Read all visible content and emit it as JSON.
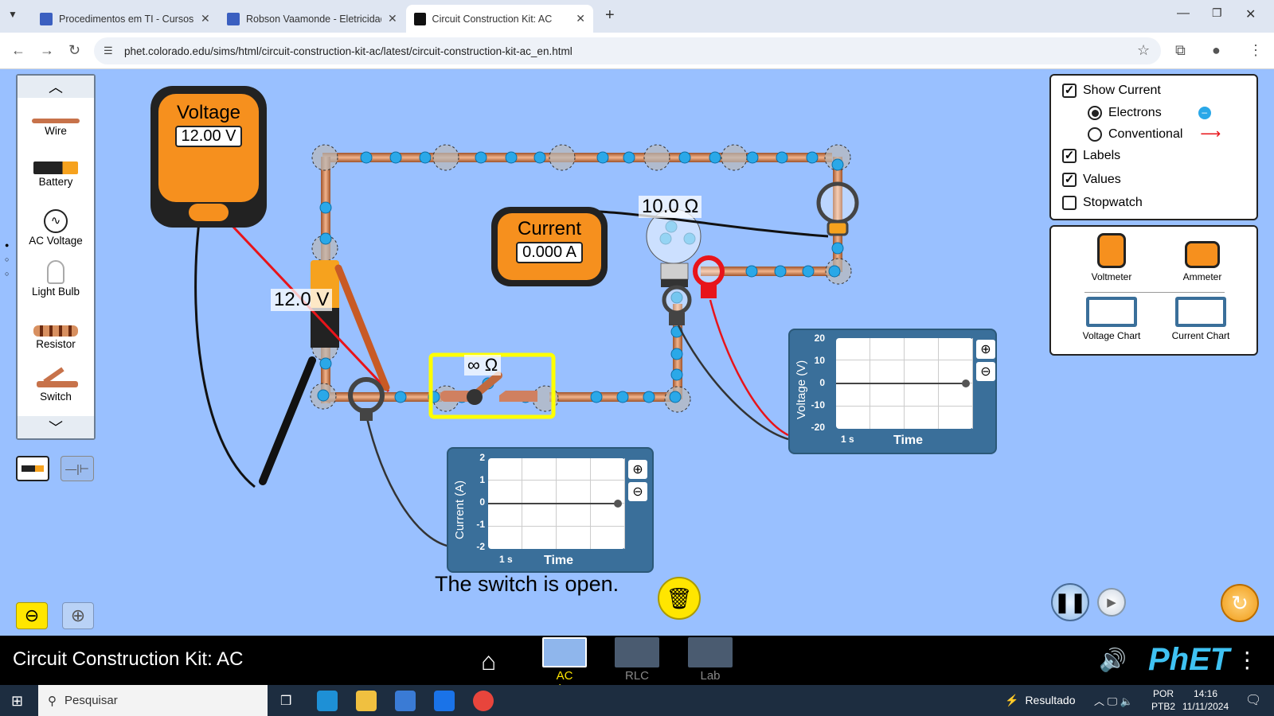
{
  "browser": {
    "tabs": [
      {
        "title": "Procedimentos em TI - Cursos T"
      },
      {
        "title": "Robson Vaamonde - Eletricidad"
      },
      {
        "title": "Circuit Construction Kit: AC"
      }
    ],
    "url": "phet.colorado.edu/sims/html/circuit-construction-kit-ac/latest/circuit-construction-kit-ac_en.html"
  },
  "toolbox": {
    "items": [
      {
        "label": "Wire"
      },
      {
        "label": "Battery"
      },
      {
        "label": "AC Voltage"
      },
      {
        "label": "Light Bulb"
      },
      {
        "label": "Resistor"
      },
      {
        "label": "Switch"
      }
    ]
  },
  "control_panel": {
    "show_current": {
      "label": "Show Current",
      "checked": true
    },
    "electrons": {
      "label": "Electrons",
      "selected": true
    },
    "conventional": {
      "label": "Conventional",
      "selected": false
    },
    "labels": {
      "label": "Labels",
      "checked": true
    },
    "values": {
      "label": "Values",
      "checked": true
    },
    "stopwatch": {
      "label": "Stopwatch",
      "checked": false
    }
  },
  "sensors": {
    "voltmeter": "Voltmeter",
    "ammeter": "Ammeter",
    "voltage_chart": "Voltage Chart",
    "current_chart": "Current Chart"
  },
  "voltmeter": {
    "title": "Voltage",
    "reading": "12.00 V"
  },
  "ammeter": {
    "title": "Current",
    "reading": "0.000 A"
  },
  "circuit_labels": {
    "battery_value": "12.0 V",
    "bulb_value": "10.0 Ω",
    "switch_value": "∞ Ω"
  },
  "voltage_chart": {
    "ylabel": "Voltage (V)",
    "xlabel": "Time",
    "ticks": [
      "20",
      "10",
      "0",
      "-10",
      "-20"
    ],
    "scale": "1 s"
  },
  "current_chart": {
    "ylabel": "Current (A)",
    "xlabel": "Time",
    "ticks": [
      "2",
      "1",
      "0",
      "-1",
      "-2"
    ],
    "scale": "1 s"
  },
  "status": "The switch is open.",
  "navbar": {
    "title": "Circuit Construction Kit: AC",
    "screens": [
      {
        "label": "AC Voltage",
        "active": true
      },
      {
        "label": "RLC",
        "active": false
      },
      {
        "label": "Lab",
        "active": false
      }
    ],
    "logo": "PhET"
  },
  "taskbar": {
    "search": "Pesquisar",
    "weather": "Resultado",
    "lang1": "POR",
    "lang2": "PTB2",
    "time": "14:16",
    "date": "11/11/2024"
  },
  "colors": {
    "sim_bg": "#99c0ff",
    "meter_orange": "#f6901e",
    "chart_panel": "#3a6f9a",
    "switch_highlight": "#ffff00",
    "probe_red": "#e8141a"
  }
}
